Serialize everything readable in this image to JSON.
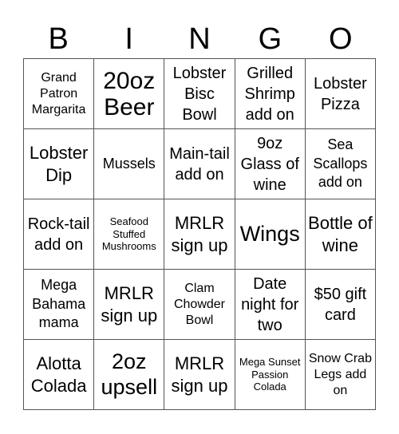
{
  "header": [
    "B",
    "I",
    "N",
    "G",
    "O"
  ],
  "cells": [
    "Grand Patron Margarita",
    "20oz Beer",
    "Lobster Bisc Bowl",
    "Grilled Shrimp add on",
    "Lobster Pizza",
    "Lobster Dip",
    "Mussels",
    "Main-tail add on",
    "9oz Glass of wine",
    "Sea Scallops add on",
    "Rock-tail add on",
    "Seafood Stuffed Mushrooms",
    "MRLR sign up",
    "Wings",
    "Bottle of wine",
    "Mega Bahama mama",
    "MRLR sign up",
    "Clam Chowder Bowl",
    "Date night for two",
    "$50 gift card",
    "Alotta Colada",
    "2oz upsell",
    "MRLR sign up",
    "Mega Sunset Passion Colada",
    "Snow Crab Legs add on"
  ]
}
